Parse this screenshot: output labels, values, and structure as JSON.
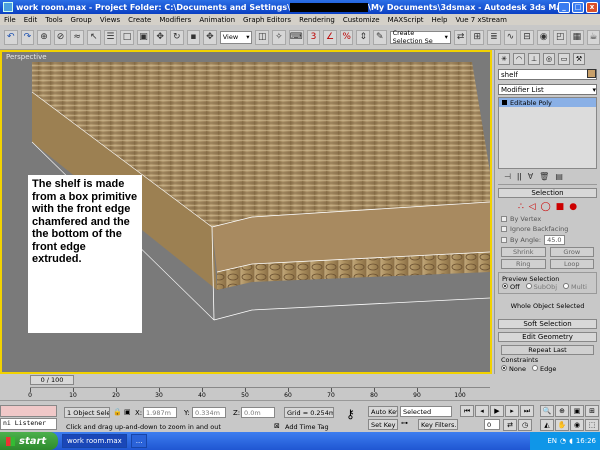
{
  "window": {
    "title_prefix": "work room.max  - Project Folder: C:\\Documents and Settings\\",
    "title_suffix": "\\My Documents\\3dsmax   - Autodesk 3ds Max  2009    - Display...",
    "min_label": "_",
    "max_label": "□",
    "close_label": "x"
  },
  "menu": [
    "File",
    "Edit",
    "Tools",
    "Group",
    "Views",
    "Create",
    "Modifiers",
    "Animation",
    "Graph Editors",
    "Rendering",
    "Customize",
    "MAXScript",
    "Help",
    "Vue 7 xStream"
  ],
  "toolbar": {
    "view_dropdown": "View",
    "selection_set": "Create Selection Se"
  },
  "viewport": {
    "label": "Perspective",
    "annotation": "The shelf is made from a box primitive with the front edge chamfered and the the bottom of the front edge extruded.",
    "wood_color": "#a08458",
    "border_color": "#f2d200"
  },
  "command_panel": {
    "object_name": "shelf",
    "swatch_color": "#c8a06a",
    "modifier_list": "Modifier List",
    "stack_items": [
      "Editable Poly"
    ],
    "selection_rollout": "Selection",
    "by_vertex": "By Vertex",
    "ignore_backfacing": "Ignore Backfacing",
    "by_angle": "By Angle:",
    "by_angle_value": "45.0",
    "shrink": "Shrink",
    "grow": "Grow",
    "ring": "Ring",
    "loop": "Loop",
    "preview_selection": "Preview Selection",
    "preview_off": "Off",
    "preview_subobj": "SubObj",
    "preview_multi": "Multi",
    "status": "Whole Object Selected",
    "soft_selection": "Soft Selection",
    "edit_geometry": "Edit Geometry",
    "repeat_last": "Repeat Last",
    "constraints": "Constraints",
    "constraint_none": "None",
    "constraint_edge": "Edge"
  },
  "timeline": {
    "slider": "0 / 100",
    "ticks": [
      "0",
      "10",
      "20",
      "30",
      "40",
      "50",
      "60",
      "70",
      "80",
      "90",
      "100"
    ]
  },
  "status": {
    "selection": "1 Object Sele",
    "x_label": "X:",
    "x_value": "1.987m",
    "y_label": "Y:",
    "y_value": "0.334m",
    "z_label": "Z:",
    "z_value": "0.0m",
    "grid": "Grid = 0.254m",
    "auto_key": "Auto Key",
    "selected": "Selected",
    "set_key": "Set Key",
    "key_filters": "Key Filters...",
    "frame": "0",
    "prompt": "Click and drag up-and-down to zoom in and out",
    "add_time_tag": "Add Time Tag",
    "listener": "ni Listener"
  },
  "taskbar": {
    "start": "start",
    "task1": "work room.max",
    "task2": "...",
    "lang": "EN",
    "clock": "16:26"
  }
}
